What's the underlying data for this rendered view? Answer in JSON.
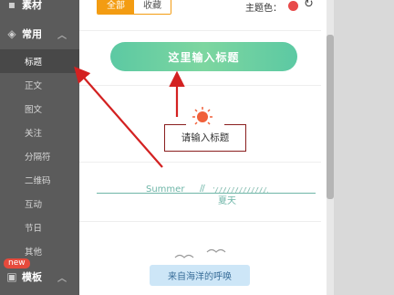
{
  "sidebar": {
    "top_category": "素材",
    "category": "常用",
    "items": [
      {
        "label": "标题",
        "active": true
      },
      {
        "label": "正文"
      },
      {
        "label": "图文"
      },
      {
        "label": "关注"
      },
      {
        "label": "分隔符"
      },
      {
        "label": "二维码"
      },
      {
        "label": "互动"
      },
      {
        "label": "节日"
      },
      {
        "label": "其他"
      }
    ],
    "new_badge": "new",
    "bottom_category": "模板"
  },
  "toolbar": {
    "tabs": [
      {
        "label": "全部",
        "active": true
      },
      {
        "label": "收藏"
      }
    ],
    "theme_label": "主题色：",
    "theme_color": "#e84a4a"
  },
  "templates": {
    "pill_title": "这里输入标题",
    "boxed_title": "请输入标题",
    "summer_en": "Summer",
    "summer_cn": "夏天",
    "sea_title": "来自海洋的呼唤"
  },
  "colors": {
    "sidebar_bg": "#5b5b5b",
    "accent": "#f39c12",
    "pill_green": "#5cc9a3",
    "arrow_red": "#d32121"
  }
}
